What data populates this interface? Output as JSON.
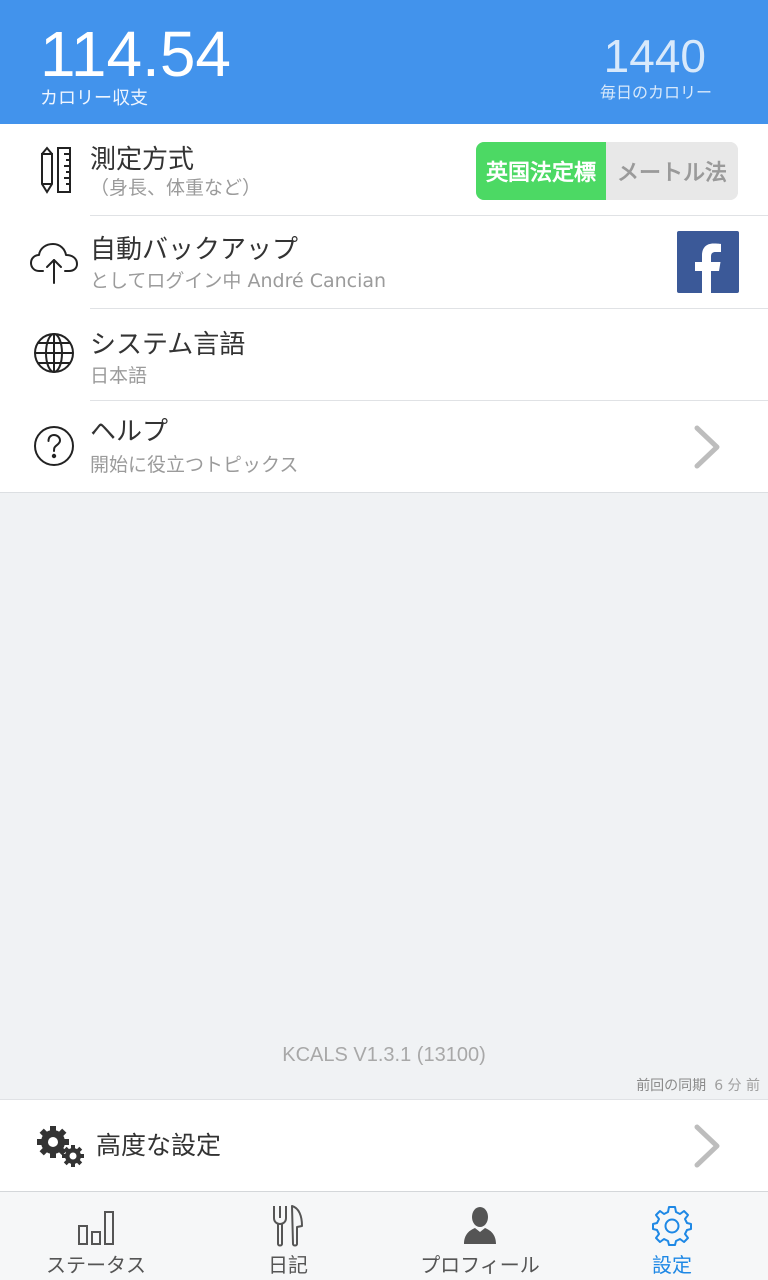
{
  "header": {
    "balance_value": "114.54",
    "balance_label": "カロリー収支",
    "daily_value": "1440",
    "daily_label": "毎日のカロリー"
  },
  "settings": {
    "measurement": {
      "title": "測定方式",
      "subtitle": "（身長、体重など）",
      "icon": "ruler-pencil-icon",
      "options": [
        "英国法定標",
        "メートル法"
      ],
      "selected": "英国法定標"
    },
    "backup": {
      "title": "自動バックアップ",
      "subtitle": "としてログイン中 André Cancian",
      "icon": "cloud-upload-icon",
      "action_icon": "facebook-icon"
    },
    "language": {
      "title": "システム言語",
      "subtitle": "日本語",
      "icon": "globe-icon"
    },
    "help": {
      "title": "ヘルプ",
      "subtitle": "開始に役立つトピックス",
      "icon": "question-icon"
    }
  },
  "version": "KCALS V1.3.1 (13100)",
  "sync": {
    "label": "前回の同期",
    "time": "6 分 前"
  },
  "advanced": {
    "label": "高度な設定",
    "icon": "gears-icon"
  },
  "nav": [
    {
      "label": "ステータス",
      "icon": "bar-chart-icon"
    },
    {
      "label": "日記",
      "icon": "fork-knife-icon"
    },
    {
      "label": "プロフィール",
      "icon": "person-icon"
    },
    {
      "label": "設定",
      "icon": "gear-icon",
      "active": true
    }
  ],
  "colors": {
    "header": "#4293ec",
    "toggle_active": "#4cd964",
    "facebook": "#3b5998",
    "nav_active": "#1e88e5"
  }
}
